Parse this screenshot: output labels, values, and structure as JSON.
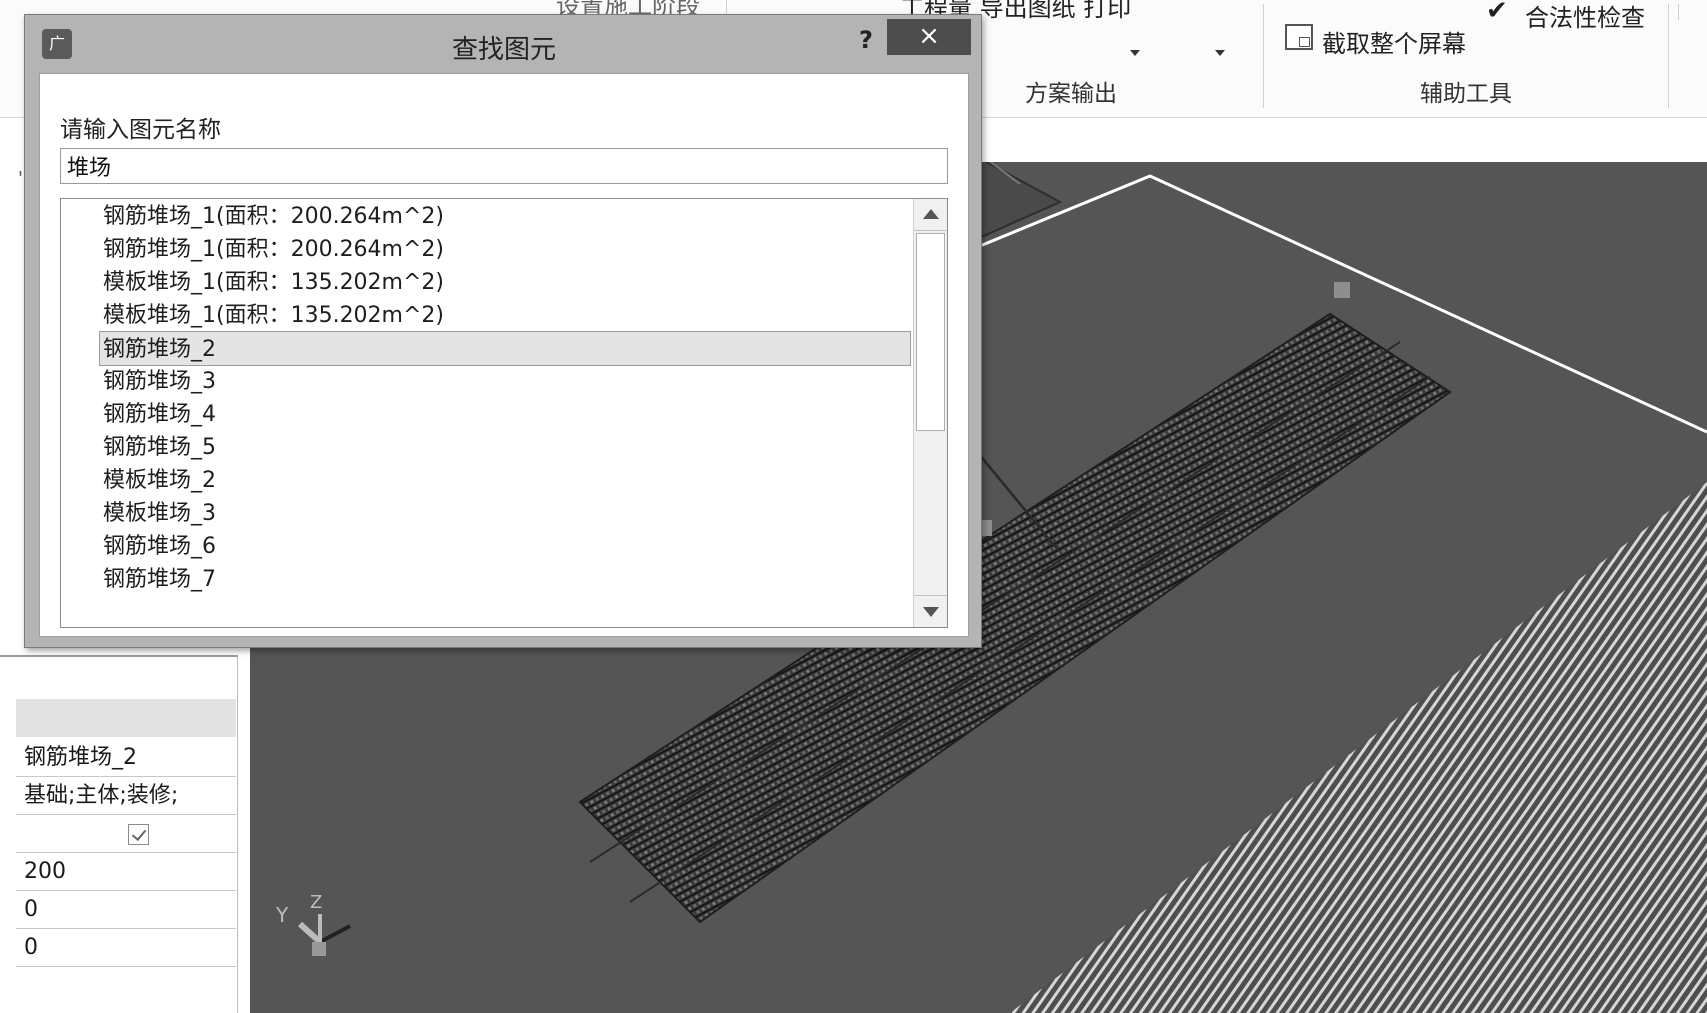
{
  "colors": {
    "viewport_bg": "#555555",
    "ground_grey": "#5a5a5a",
    "dialog_frame": "#b4b4b4",
    "close_button": "#4d4d4d",
    "selected_row": "#e4e4e4",
    "boundary_line": "#ffffff"
  },
  "ribbon": {
    "top_left_cutoff": "设置施工阶段",
    "top_mid_cutoff": "工程量 导出图纸 打印",
    "validity_check": "合法性检查",
    "capture_screen": "截取整个屏幕",
    "group_output": "方案输出",
    "group_tools": "辅助工具",
    "icons": [
      "checkmark-icon",
      "screenshot-icon",
      "dropdown-arrow-icon"
    ]
  },
  "dialog": {
    "title": "查找图元",
    "help_label": "?",
    "close_label": "×",
    "app_icon_label": "广",
    "prompt": "请输入图元名称",
    "search_value": "堆场",
    "results": [
      "钢筋堆场_1(面积：200.264m^2)",
      "钢筋堆场_1(面积：200.264m^2)",
      "模板堆场_1(面积：135.202m^2)",
      "模板堆场_1(面积：135.202m^2)",
      "钢筋堆场_2",
      "钢筋堆场_3",
      "钢筋堆场_4",
      "钢筋堆场_5",
      "模板堆场_2",
      "模板堆场_3",
      "钢筋堆场_6",
      "钢筋堆场_7"
    ],
    "selected_index": 4
  },
  "properties": {
    "name_value": "钢筋堆场_2",
    "stage_value": "基础;主体;装修;",
    "visible_checked": true,
    "value_1": "200",
    "value_2": "0",
    "value_3": "0"
  },
  "axes": {
    "y_label": "Y",
    "z_label": "Z"
  }
}
